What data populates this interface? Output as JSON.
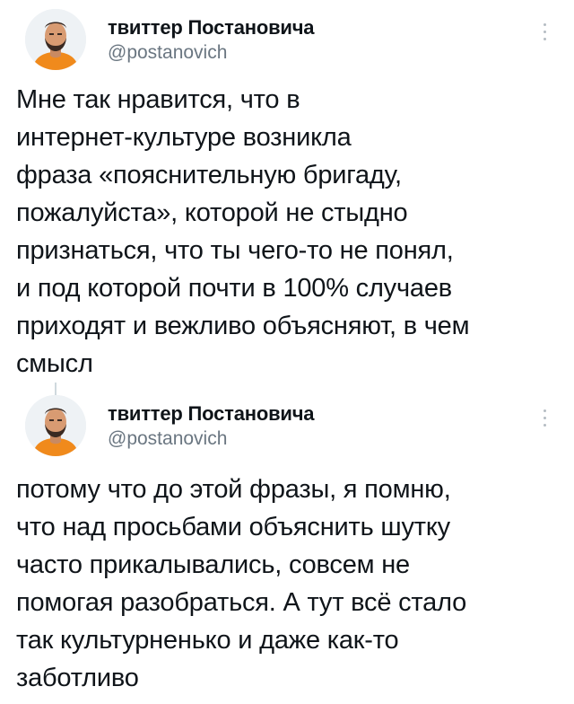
{
  "tweets": [
    {
      "author_name": "твиттер Постановича",
      "author_handle": "@postanovich",
      "avatar_icon": "person-avatar",
      "more_icon": "vertical-dots-icon",
      "lines": [
        "Мне так нравится, что в",
        "интернет-культуре возникла",
        "фраза «пояснительную бригаду,",
        "пожалуйста», которой не стыдно",
        "признаться, что ты чего-то не понял,",
        "и под которой почти в 100% случаев",
        "приходят и вежливо объясняют, в чем",
        "смысл"
      ]
    },
    {
      "author_name": "твиттер Постановича",
      "author_handle": "@postanovich",
      "avatar_icon": "person-avatar",
      "more_icon": "vertical-dots-icon",
      "lines": [
        "потому что до этой фразы, я помню,",
        "что над просьбами объяснить шутку",
        "часто прикалывались, совсем не",
        "помогая разобраться. А тут всё стало",
        "так культурненько и даже как-то",
        "заботливо"
      ]
    }
  ],
  "colors": {
    "text": "#0f1419",
    "secondary": "#6a7681",
    "avatar_shirt": "#f08a1c",
    "thread_line": "#cfd9de"
  }
}
